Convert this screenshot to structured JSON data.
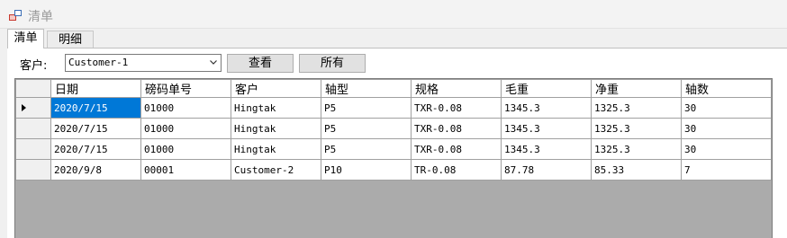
{
  "window": {
    "title": "清单"
  },
  "tabs": [
    {
      "label": "清单",
      "active": true
    },
    {
      "label": "明细",
      "active": false
    }
  ],
  "filter": {
    "customer_label": "客户:",
    "customer_value": "Customer-1",
    "view_button": "查看",
    "all_button": "所有"
  },
  "grid": {
    "columns": [
      "日期",
      "磅码单号",
      "客户",
      "轴型",
      "规格",
      "毛重",
      "净重",
      "轴数"
    ],
    "rows": [
      [
        "2020/7/15",
        "01000",
        "Hingtak",
        "P5",
        "TXR-0.08",
        "1345.3",
        "1325.3",
        "30"
      ],
      [
        "2020/7/15",
        "01000",
        "Hingtak",
        "P5",
        "TXR-0.08",
        "1345.3",
        "1325.3",
        "30"
      ],
      [
        "2020/7/15",
        "01000",
        "Hingtak",
        "P5",
        "TXR-0.08",
        "1345.3",
        "1325.3",
        "30"
      ],
      [
        "2020/9/8",
        "00001",
        "Customer-2",
        "P10",
        "TR-0.08",
        "87.78",
        "85.33",
        "7"
      ]
    ],
    "selected_row": 0,
    "selected_col": 0,
    "selection_color": "#0078d7",
    "empty_area_color": "#ababab"
  }
}
